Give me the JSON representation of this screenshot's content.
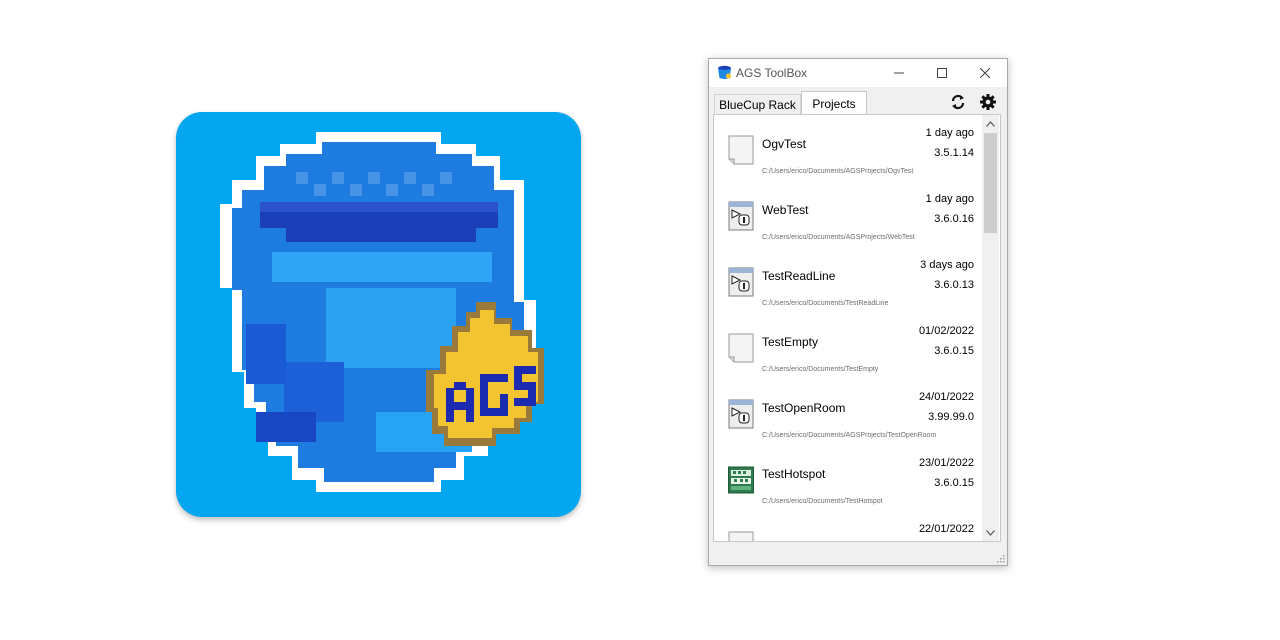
{
  "app_icon": {
    "name": "ags-bluecup-app-icon",
    "badge_text": "AGS"
  },
  "window": {
    "title": "AGS ToolBox",
    "title_icon": "bluecup-icon",
    "controls": {
      "minimize": "minimize-icon",
      "maximize": "maximize-icon",
      "close": "close-icon"
    }
  },
  "tabs": [
    {
      "label": "BlueCup Rack",
      "active": false
    },
    {
      "label": "Projects",
      "active": true
    }
  ],
  "toolbar": {
    "refresh": "refresh-icon",
    "settings": "gear-icon"
  },
  "projects": [
    {
      "name": "OgvTest",
      "date": "1 day ago",
      "version": "3.5.1.14",
      "path": "C:/Users/erico/Documents/AGSProjects/OgvTest",
      "icon": "blank-document-icon"
    },
    {
      "name": "WebTest",
      "date": "1 day ago",
      "version": "3.6.0.16",
      "path": "C:/Users/erico/Documents/AGSProjects/WebTest",
      "icon": "ags-game-icon"
    },
    {
      "name": "TestReadLine",
      "date": "3 days ago",
      "version": "3.6.0.13",
      "path": "C:/Users/erico/Documents/TestReadLine",
      "icon": "ags-game-icon"
    },
    {
      "name": "TestEmpty",
      "date": "01/02/2022",
      "version": "3.6.0.15",
      "path": "C:/Users/erico/Documents/TestEmpty",
      "icon": "blank-document-icon"
    },
    {
      "name": "TestOpenRoom",
      "date": "24/01/2022",
      "version": "3.99.99.0",
      "path": "C:/Users/erico/Documents/AGSProjects/TestOpenRoom",
      "icon": "ags-game-icon"
    },
    {
      "name": "TestHotspot",
      "date": "23/01/2022",
      "version": "3.6.0.15",
      "path": "C:/Users/erico/Documents/TestHotspot",
      "icon": "green-game-icon"
    },
    {
      "name": "",
      "date": "22/01/2022",
      "version": "",
      "path": "",
      "icon": "blank-document-icon"
    }
  ],
  "colors": {
    "icon_background": "#04a6ef",
    "cup_blue": "#1e88e5",
    "badge_yellow": "#f4c430"
  }
}
